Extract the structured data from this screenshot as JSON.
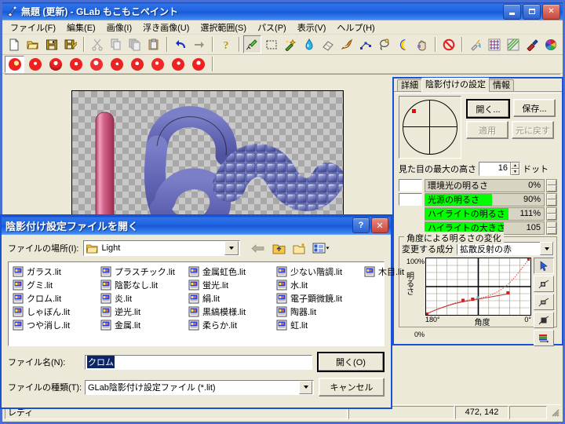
{
  "window": {
    "title": "無題 (更新) - GLab もこもこペイント",
    "icon": "paint-app-icon",
    "minimize_label": "_",
    "maximize_label": "□",
    "close_label": "✕"
  },
  "menubar": {
    "items": [
      {
        "label": "ファイル(F)"
      },
      {
        "label": "編集(E)"
      },
      {
        "label": "画像(I)"
      },
      {
        "label": "浮き画像(U)"
      },
      {
        "label": "選択範囲(S)"
      },
      {
        "label": "パス(P)"
      },
      {
        "label": "表示(V)"
      },
      {
        "label": "ヘルプ(H)"
      }
    ]
  },
  "toolbar": {
    "buttons": [
      {
        "name": "new-file-icon"
      },
      {
        "name": "open-file-icon"
      },
      {
        "name": "save-file-icon"
      },
      {
        "name": "save-as-icon"
      },
      {
        "name": "cut-icon"
      },
      {
        "name": "copy-icon"
      },
      {
        "name": "copy-merged-icon"
      },
      {
        "name": "paste-icon"
      },
      {
        "name": "undo-icon"
      },
      {
        "name": "redo-icon"
      },
      {
        "name": "help-icon"
      },
      {
        "name": "pen-tool-icon"
      },
      {
        "name": "select-rect-icon"
      },
      {
        "name": "magic-wand-icon"
      },
      {
        "name": "water-drop-icon"
      },
      {
        "name": "eraser-icon"
      },
      {
        "name": "smear-icon"
      },
      {
        "name": "path-node-icon"
      },
      {
        "name": "lasso-icon"
      },
      {
        "name": "moon-shade-icon"
      },
      {
        "name": "hand-move-icon"
      },
      {
        "name": "no-entry-icon"
      },
      {
        "name": "airbrush-icon"
      },
      {
        "name": "pattern-icon"
      },
      {
        "name": "texture-icon"
      },
      {
        "name": "palette-brush-icon"
      },
      {
        "name": "color-wheel-icon"
      }
    ],
    "brush_sizes": [
      {
        "name": "brush-preset-1",
        "selected": true
      },
      {
        "name": "brush-preset-2",
        "selected": false
      },
      {
        "name": "brush-preset-3",
        "selected": false
      },
      {
        "name": "brush-preset-4",
        "selected": false
      },
      {
        "name": "brush-preset-5",
        "selected": false
      },
      {
        "name": "brush-preset-6",
        "selected": false
      },
      {
        "name": "brush-preset-7",
        "selected": false
      },
      {
        "name": "brush-preset-8",
        "selected": false
      },
      {
        "name": "brush-preset-9",
        "selected": false
      },
      {
        "name": "brush-preset-10",
        "selected": false
      }
    ]
  },
  "statusbar": {
    "message": "レディ",
    "coordinates": "472, 142",
    "extra": ""
  },
  "panel": {
    "tabs": [
      {
        "label": "詳細",
        "active": false
      },
      {
        "label": "陰影付けの設定",
        "active": true
      },
      {
        "label": "情報",
        "active": false
      }
    ],
    "light_direction": {
      "name": "light-direction-picker",
      "dot_x": 16,
      "dot_y": 16
    },
    "buttons": {
      "open": "開く...",
      "save": "保存...",
      "apply": "適用",
      "revert": "元に戻す"
    },
    "max_height": {
      "label": "見た目の最大の高さ",
      "value": "16",
      "unit": "ドット"
    },
    "sliders": [
      {
        "label": "環境光の明るさ",
        "value": "0%",
        "fill_pct": 0,
        "swatch": true,
        "swatch_color": "#ffffff"
      },
      {
        "label": "光源の明るさ",
        "value": "90%",
        "fill_pct": 56,
        "swatch": true,
        "swatch_color": "#ffffff"
      },
      {
        "label": "ハイライトの明るさ",
        "value": "111%",
        "fill_pct": 70,
        "swatch": false,
        "swatch_color": "#ffffff"
      },
      {
        "label": "ハイライトの大きさ",
        "value": "105",
        "fill_pct": 66,
        "swatch": false,
        "swatch_color": "#ffffff"
      }
    ],
    "curve_group": {
      "title": "角度による明るさの変化",
      "component_label": "変更する成分",
      "component_value": "拡散反射の赤",
      "y_max": "100%",
      "y_min": "0%",
      "y_axis_label": "明るさ",
      "x_left": "180°",
      "x_label": "角度",
      "x_right": "0°",
      "tools": [
        {
          "name": "curve-select-tool-icon",
          "selected": true
        },
        {
          "name": "curve-add-point-tool-icon",
          "selected": false
        },
        {
          "name": "curve-edit-point-tool-icon",
          "selected": false
        },
        {
          "name": "curve-move-point-tool-icon",
          "selected": false
        },
        {
          "name": "curve-channels-icon",
          "selected": false
        }
      ]
    }
  },
  "chart_data": {
    "type": "line",
    "title": "角度による明るさの変化",
    "xlabel": "角度",
    "ylabel": "明るさ",
    "xlim": [
      180,
      0
    ],
    "ylim": [
      0,
      100
    ],
    "grid": true,
    "series": [
      {
        "name": "拡散反射の赤",
        "color": "#d84040",
        "x": [
          180,
          126,
          108,
          90,
          54,
          0
        ],
        "y": [
          2,
          18,
          20,
          22,
          28,
          100
        ],
        "points_marked": [
          126,
          108,
          54
        ]
      }
    ]
  },
  "dialog": {
    "title": "陰影付け設定ファイルを開く",
    "help_label": "?",
    "close_label": "✕",
    "look_in_label": "ファイルの場所(I):",
    "look_in_value": "Light",
    "nav_icons": [
      {
        "name": "back-arrow-icon"
      },
      {
        "name": "up-one-level-icon"
      },
      {
        "name": "new-folder-icon"
      },
      {
        "name": "view-menu-icon"
      }
    ],
    "files": [
      "ガラス.lit",
      "グミ.lit",
      "クロム.lit",
      "しゃぼん.lit",
      "つや消し.lit",
      "プラスチック.lit",
      "陰影なし.lit",
      "炎.lit",
      "逆光.lit",
      "金属.lit",
      "金属虹色.lit",
      "蛍光.lit",
      "絹.lit",
      "黒縞模様.lit",
      "柔らか.lit",
      "少ない階調.lit",
      "水.lit",
      "電子顕微鏡.lit",
      "陶器.lit",
      "虹.lit",
      "木目.lit"
    ],
    "filename_label": "ファイル名(N):",
    "filename_value": "クロム",
    "filetype_label": "ファイルの種類(T):",
    "filetype_value": "GLab陰影付け設定ファイル (*.lit)",
    "open_button": "開く(O)",
    "cancel_button": "キャンセル"
  }
}
